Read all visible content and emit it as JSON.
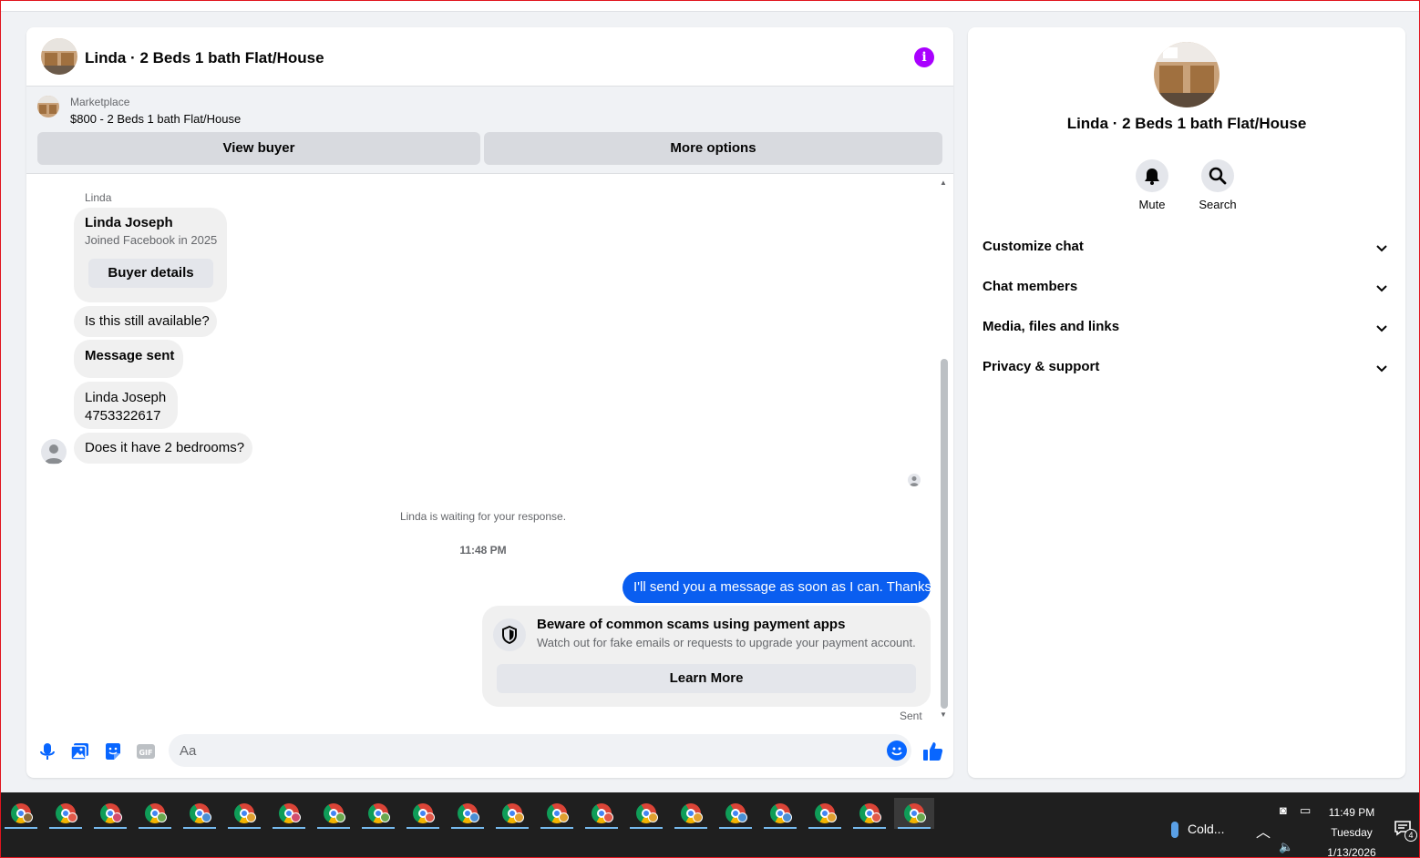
{
  "chat": {
    "title": "Linda · 2 Beds 1 bath Flat/House",
    "info_icon": "info-icon",
    "marketplace": {
      "label": "Marketplace",
      "listing": "$800 - 2 Beds 1 bath Flat/House",
      "view_buyer_label": "View buyer",
      "more_options_label": "More options"
    },
    "sender_name": "Linda",
    "buyer_card": {
      "name": "Linda Joseph",
      "joined": "Joined Facebook in 2025",
      "button_label": "Buyer details"
    },
    "messages": {
      "availability": "Is this still available?",
      "message_sent": "Message sent",
      "contact_name": "Linda Joseph",
      "contact_phone": "4753322617",
      "bedrooms": "Does it have 2 bedrooms?"
    },
    "waiting_notice": "Linda is waiting for your response.",
    "timestamp": "11:48 PM",
    "outgoing": "I'll send you a message as soon as I can. Thanks",
    "scam_warning": {
      "title": "Beware of common scams using payment apps",
      "text": "Watch out for fake emails or requests to upgrade your payment account.",
      "button_label": "Learn More"
    },
    "delivery_status": "Sent",
    "composer": {
      "placeholder": "Aa",
      "value": ""
    }
  },
  "info_panel": {
    "title": "Linda · 2 Beds 1 bath Flat/House",
    "actions": {
      "mute_label": "Mute",
      "search_label": "Search"
    },
    "sections": [
      "Customize chat",
      "Chat members",
      "Media, files and links",
      "Privacy & support"
    ]
  },
  "taskbar": {
    "apps": [
      {
        "badge_color": "#8a6a3a"
      },
      {
        "badge_color": "#e05a4a"
      },
      {
        "badge_color": "#d14d6e"
      },
      {
        "badge_color": "#6aa84f"
      },
      {
        "badge_color": "#4a8fd4"
      },
      {
        "badge_color": "#e0a030"
      },
      {
        "badge_color": "#d14d6e"
      },
      {
        "badge_color": "#6aa84f"
      },
      {
        "badge_color": "#6aa84f"
      },
      {
        "badge_color": "#e05a4a"
      },
      {
        "badge_color": "#4a8fd4"
      },
      {
        "badge_color": "#e0a030"
      },
      {
        "badge_color": "#e0a030"
      },
      {
        "badge_color": "#e05a4a"
      },
      {
        "badge_color": "#e0a030"
      },
      {
        "badge_color": "#e0a030"
      },
      {
        "badge_color": "#4a8fd4"
      },
      {
        "badge_color": "#4a8fd4"
      },
      {
        "badge_color": "#e0a030"
      },
      {
        "badge_color": "#e05a4a"
      },
      {
        "badge_color": "#6aa84f"
      }
    ],
    "weather": "Cold...",
    "time": "11:49 PM",
    "day": "Tuesday",
    "date": "1/13/2026",
    "notification_count": "4"
  },
  "colors": {
    "accent_blue": "#0a5ef0",
    "info_purple": "#a900ff",
    "frame_red": "#e0141e"
  }
}
